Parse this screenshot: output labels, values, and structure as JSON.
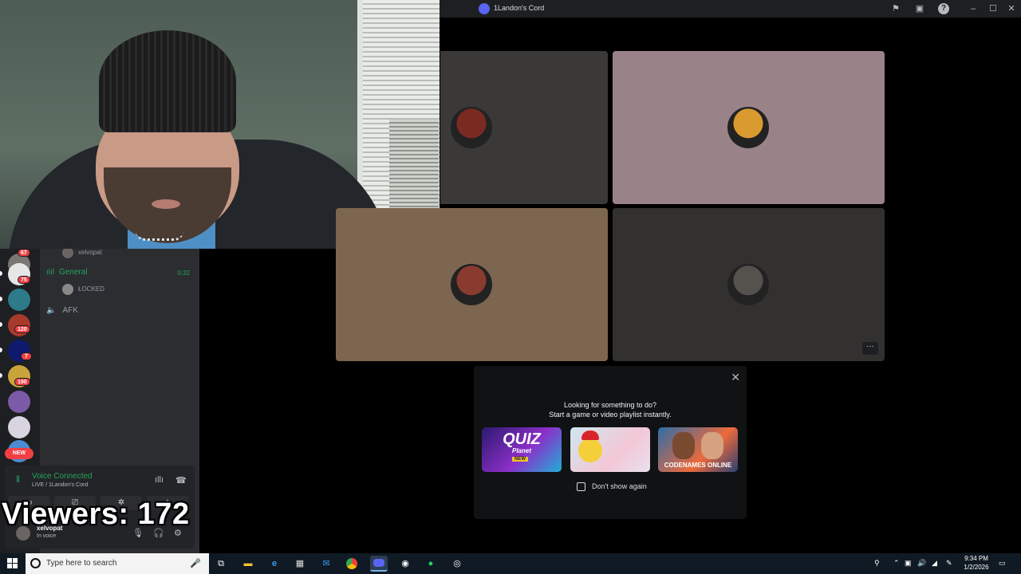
{
  "window": {
    "title": "1Landon's Cord",
    "controls": [
      "minimize",
      "maximize",
      "close"
    ]
  },
  "server_rail": {
    "badges": [
      "67",
      "75",
      "120",
      "7",
      "190"
    ],
    "new_label": "NEW"
  },
  "channels": {
    "top_user": "xelvopat",
    "general": {
      "name": "General",
      "timer": "0:32",
      "user": "ŁOCKED"
    },
    "afk": {
      "name": "AFK"
    }
  },
  "voice_panel": {
    "title": "Voice Connected",
    "subtitle": "LIVE / 1Landon's Cord",
    "username": "xelvopat",
    "status": "In voice"
  },
  "overlay": {
    "viewers": "Viewers: 172"
  },
  "video_grid": {
    "tiles": [
      {
        "bg": "#3a3938",
        "avatar_color": "#7b2a22"
      },
      {
        "bg": "#9a8289",
        "avatar_color": "#d99a30"
      },
      {
        "bg": "#7c6650",
        "avatar_color": "#8a3b30"
      },
      {
        "bg": "#33312f",
        "avatar_color": "#55524e"
      }
    ],
    "more_label": "···"
  },
  "activity_popup": {
    "line1": "Looking for something to do?",
    "line2": "Start a game or video playlist instantly.",
    "cards": [
      {
        "title": "QUIZ",
        "subtitle": "Planet",
        "tag": "NEW"
      },
      {
        "title": "",
        "subtitle": "",
        "tag": ""
      },
      {
        "title": "CODENAMES ONLINE",
        "subtitle": "",
        "tag": ""
      }
    ],
    "checkbox_label": "Don't show again",
    "close_label": "✕"
  },
  "taskbar": {
    "search_placeholder": "Type here to search",
    "time": "9:34 PM",
    "date": "1/2/2026"
  }
}
